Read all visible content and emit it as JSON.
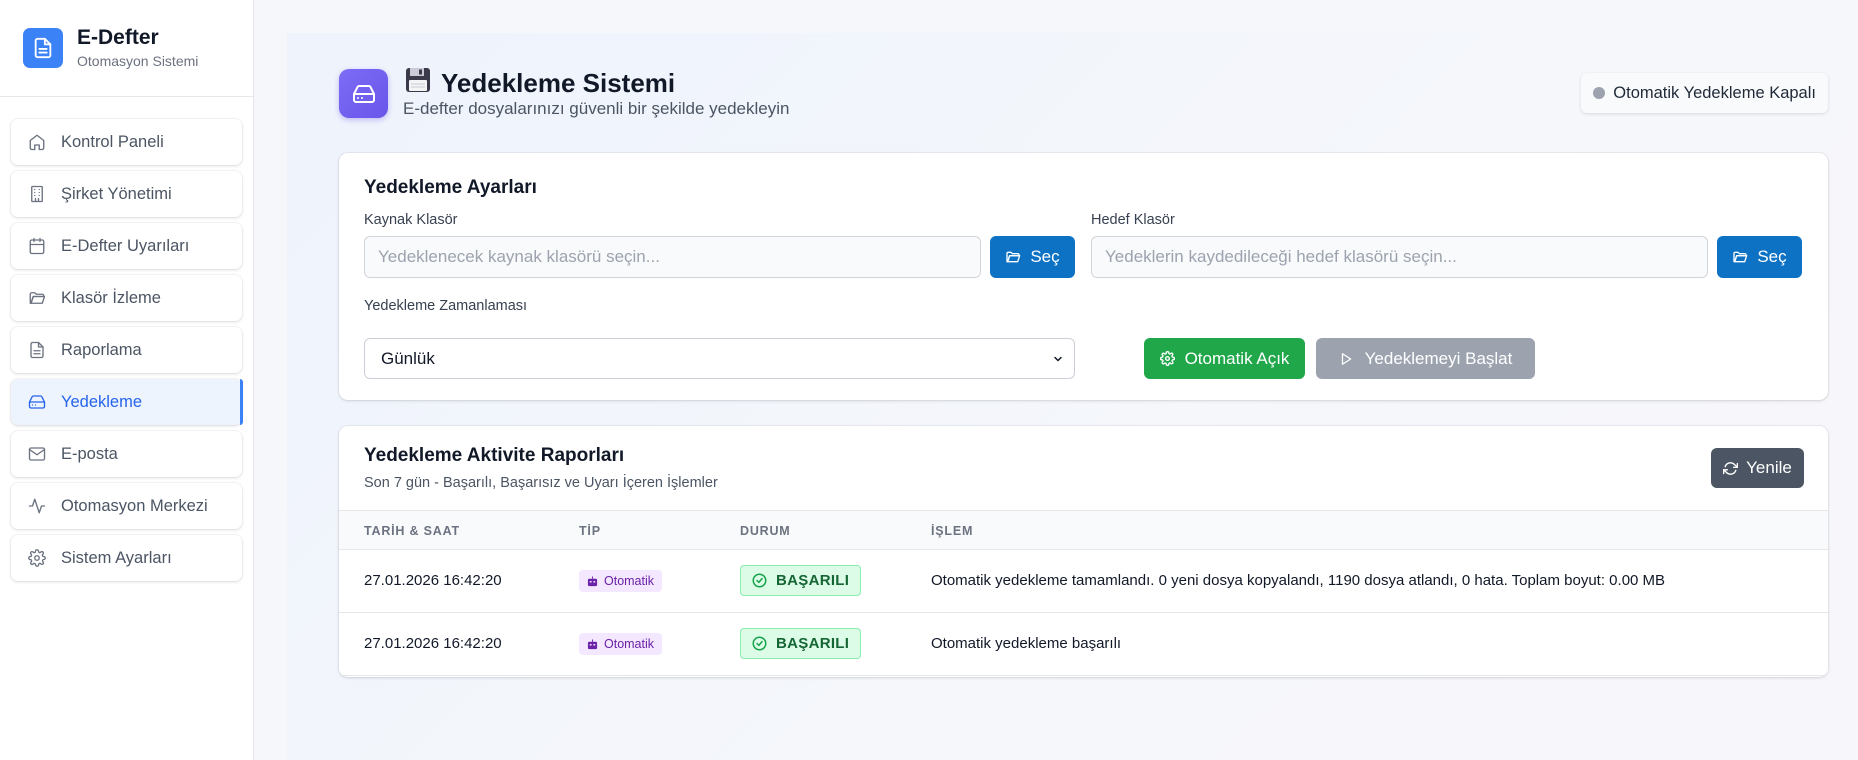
{
  "brand": {
    "title": "E-Defter",
    "subtitle": "Otomasyon Sistemi",
    "icon": "document-icon"
  },
  "sidebar": {
    "items": [
      {
        "label": "Kontrol Paneli",
        "icon": "home-icon",
        "active": false
      },
      {
        "label": "Şirket Yönetimi",
        "icon": "building-icon",
        "active": false
      },
      {
        "label": "E-Defter Uyarıları",
        "icon": "calendar-icon",
        "active": false
      },
      {
        "label": "Klasör İzleme",
        "icon": "folder-open-icon",
        "active": false
      },
      {
        "label": "Raporlama",
        "icon": "document-icon",
        "active": false
      },
      {
        "label": "Yedekleme",
        "icon": "hard-drive-icon",
        "active": true
      },
      {
        "label": "E-posta",
        "icon": "mail-icon",
        "active": false
      },
      {
        "label": "Otomasyon Merkezi",
        "icon": "activity-icon",
        "active": false
      },
      {
        "label": "Sistem Ayarları",
        "icon": "gear-icon",
        "active": false
      }
    ]
  },
  "header": {
    "title": "Yedekleme Sistemi",
    "title_emoji": "💾",
    "subtitle": "E-defter dosyalarınızı güvenli bir şekilde yedekleyin",
    "auto_status": "Otomatik Yedekleme Kapalı"
  },
  "settings": {
    "title": "Yedekleme Ayarları",
    "source_label": "Kaynak Klasör",
    "source_placeholder": "Yedeklenecek kaynak klasörü seçin...",
    "target_label": "Hedef Klasör",
    "target_placeholder": "Yedeklerin kaydedileceği hedef klasörü seçin...",
    "select_button": "Seç",
    "schedule_label": "Yedekleme Zamanlaması",
    "schedule_value": "Günlük",
    "auto_button": "Otomatik Açık",
    "start_button": "Yedeklemeyi Başlat"
  },
  "reports": {
    "title": "Yedekleme Aktivite Raporları",
    "subtitle": "Son 7 gün - Başarılı, Başarısız ve Uyarı İçeren İşlemler",
    "refresh_button": "Yenile",
    "columns": [
      "TARİH & SAAT",
      "TİP",
      "DURUM",
      "İŞLEM"
    ],
    "rows": [
      {
        "datetime": "27.01.2026 16:42:20",
        "type": "Otomatik",
        "status": "BAŞARILI",
        "action": "Otomatik yedekleme tamamlandı. 0 yeni dosya kopyalandı, 1190 dosya atlandı, 0 hata. Toplam boyut: 0.00 MB"
      },
      {
        "datetime": "27.01.2026 16:42:20",
        "type": "Otomatik",
        "status": "BAŞARILI",
        "action": "Otomatik yedekleme başarılı"
      }
    ]
  },
  "colors": {
    "primary": "#0e72c4",
    "success": "#1fa74a",
    "disabled": "#9ca3af",
    "accent_purple": "#6a55ea",
    "active_nav": "#2563eb"
  }
}
